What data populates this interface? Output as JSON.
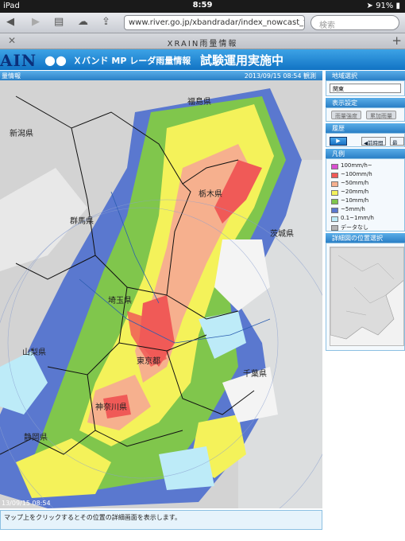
{
  "statusbar": {
    "device": "iPad",
    "time": "8:59",
    "battery": "91%"
  },
  "browser": {
    "url": "www.river.go.jp/xbandradar/index_nowcast_to",
    "search_placeholder": "検索",
    "tab_title": "XRAIN雨量情報"
  },
  "banner": {
    "logo": "AIN",
    "title": "Ｘバンド MP レーダ雨量情報",
    "subtitle": "試験運用実施中"
  },
  "map": {
    "header_label": "量情報",
    "timestamp": "2013/09/15 08:54 観測",
    "footer_timestamp": "13/09/15 08:54",
    "prefectures": [
      "新潟県",
      "福島県",
      "栃木県",
      "群馬県",
      "茨城県",
      "埼玉県",
      "山梨県",
      "東京都",
      "神奈川県",
      "静岡県",
      "千葉県"
    ]
  },
  "info_text": "マップ上をクリックするとその位置の詳細画面を表示します。",
  "sidebar": {
    "region": {
      "title": "地域選択",
      "selected": "関東"
    },
    "display": {
      "title": "表示設定",
      "btn1": "雨量強度",
      "btn2": "累加雨量"
    },
    "history": {
      "title": "履歴",
      "play": "▶",
      "back": "◀前時間",
      "forward": "最新▶"
    },
    "legend": {
      "title": "凡例",
      "items": [
        {
          "label": "100mm/h~",
          "color": "#d94fd1"
        },
        {
          "label": "~100mm/h",
          "color": "#f05a57"
        },
        {
          "label": "~50mm/h",
          "color": "#f6b08e"
        },
        {
          "label": "~20mm/h",
          "color": "#f4f25a"
        },
        {
          "label": "~10mm/h",
          "color": "#80c64c"
        },
        {
          "label": "~5mm/h",
          "color": "#5a78cf"
        },
        {
          "label": "0.1~1mm/h",
          "color": "#bdebf8"
        },
        {
          "label": "データなし",
          "color": "#b4b4b4"
        }
      ]
    },
    "detail": {
      "title": "詳細図の位置選択"
    }
  }
}
